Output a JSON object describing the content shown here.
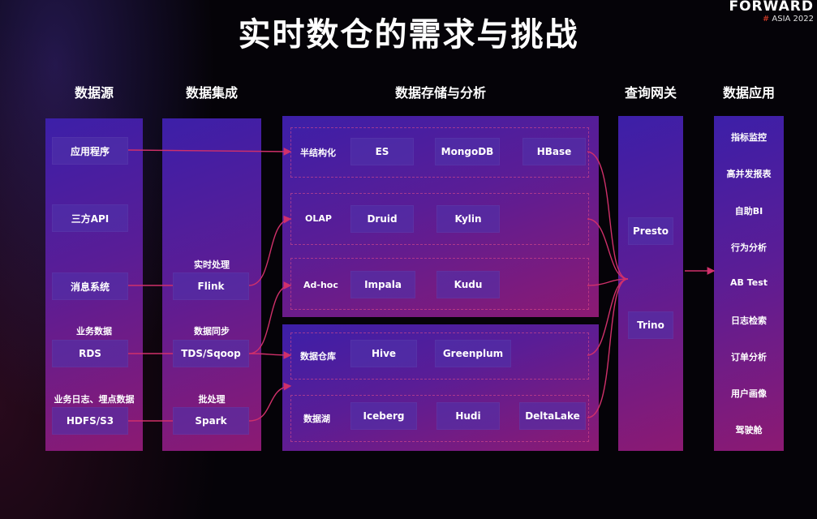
{
  "title": "实时数仓的需求与挑战",
  "logo": {
    "line1": "FORWARD",
    "hash": "#",
    "line2": "ASIA 2022"
  },
  "columns": {
    "sources": "数据源",
    "integration": "数据集成",
    "storage": "数据存储与分析",
    "gateway": "查询网关",
    "apps": "数据应用"
  },
  "sources": {
    "app": "应用程序",
    "api": "三方API",
    "msg": "消息系统",
    "biz_label": "业务数据",
    "rds": "RDS",
    "log_label": "业务日志、埋点数据",
    "hdfs": "HDFS/S3"
  },
  "integration": {
    "rt_label": "实时处理",
    "flink": "Flink",
    "sync_label": "数据同步",
    "tds": "TDS/Sqoop",
    "batch_label": "批处理",
    "spark": "Spark"
  },
  "storage": {
    "semi": {
      "label": "半结构化",
      "items": [
        "ES",
        "MongoDB",
        "HBase"
      ]
    },
    "olap": {
      "label": "OLAP",
      "items": [
        "Druid",
        "Kylin"
      ]
    },
    "adhoc": {
      "label": "Ad-hoc",
      "items": [
        "Impala",
        "Kudu"
      ]
    },
    "dw": {
      "label": "数据仓库",
      "items": [
        "Hive",
        "Greenplum"
      ]
    },
    "lake": {
      "label": "数据湖",
      "items": [
        "Iceberg",
        "Hudi",
        "DeltaLake"
      ]
    }
  },
  "gateway": {
    "items": [
      "Presto",
      "Trino"
    ]
  },
  "apps": [
    "指标监控",
    "高并发报表",
    "自助BI",
    "行为分析",
    "AB Test",
    "日志检索",
    "订单分析",
    "用户画像",
    "驾驶舱"
  ],
  "colors": {
    "link": "#d0306a",
    "accent": "#e8402a"
  }
}
